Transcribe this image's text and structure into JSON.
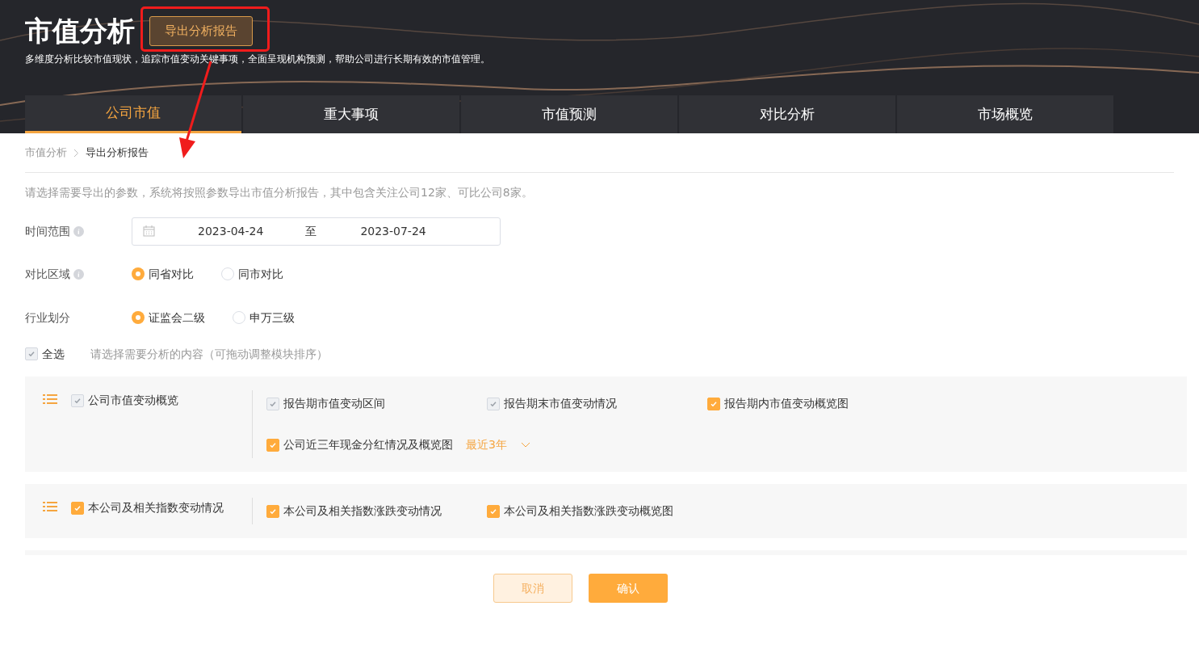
{
  "header": {
    "title": "市值分析",
    "export_button": "导出分析报告",
    "subtitle": "多维度分析比较市值现状，追踪市值变动关键事项，全面呈现机构预测，帮助公司进行长期有效的市值管理。"
  },
  "tabs": [
    {
      "label": "公司市值",
      "selected": true
    },
    {
      "label": "重大事项",
      "selected": false
    },
    {
      "label": "市值预测",
      "selected": false
    },
    {
      "label": "对比分析",
      "selected": false
    },
    {
      "label": "市场概览",
      "selected": false
    }
  ],
  "breadcrumb": [
    {
      "label": "市值分析",
      "current": false
    },
    {
      "label": "导出分析报告",
      "current": true
    }
  ],
  "intro": "请选择需要导出的参数，系统将按照参数导出市值分析报告，其中包含关注公司12家、可比公司8家。",
  "time_range": {
    "label": "时间范围",
    "info": true,
    "start": "2023-04-24",
    "separator": "至",
    "end": "2023-07-24"
  },
  "region": {
    "label": "对比区域",
    "info": true,
    "options": [
      {
        "label": "同省对比",
        "selected": true
      },
      {
        "label": "同市对比",
        "selected": false
      }
    ]
  },
  "industry": {
    "label": "行业划分",
    "info": false,
    "options": [
      {
        "label": "证监会二级",
        "selected": true
      },
      {
        "label": "申万三级",
        "selected": false
      }
    ]
  },
  "select_all": {
    "label": "全选",
    "checked": true,
    "disabled": true,
    "hint": "请选择需要分析的内容（可拖动调整模块排序）"
  },
  "sections": [
    {
      "title": "公司市值变动概览",
      "checked": true,
      "disabled": true,
      "rows": [
        [
          {
            "label": "报告期市值变动区间",
            "checked": true,
            "disabled": true
          },
          {
            "label": "报告期末市值变动情况",
            "checked": true,
            "disabled": true
          },
          {
            "label": "报告期内市值变动概览图",
            "checked": true,
            "disabled": false
          }
        ],
        [
          {
            "label": "公司近三年现金分红情况及概览图",
            "checked": true,
            "disabled": false,
            "dropdown": "最近3年"
          }
        ]
      ]
    },
    {
      "title": "本公司及相关指数变动情况",
      "checked": true,
      "disabled": false,
      "rows": [
        [
          {
            "label": "本公司及相关指数涨跌变动情况",
            "checked": true,
            "disabled": false
          },
          {
            "label": "本公司及相关指数涨跌变动概览图",
            "checked": true,
            "disabled": false
          }
        ]
      ]
    }
  ],
  "buttons": {
    "cancel": "取消",
    "confirm": "确认"
  }
}
